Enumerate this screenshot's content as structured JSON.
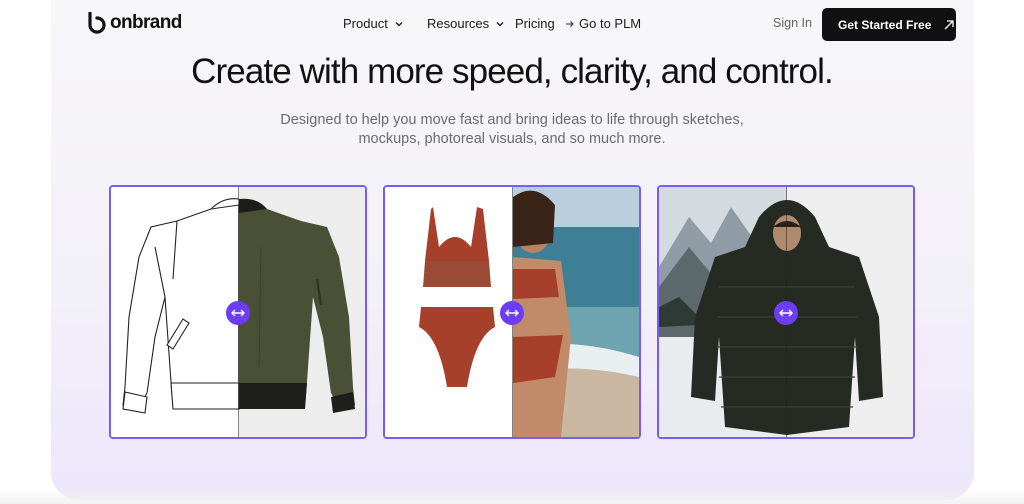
{
  "brand": {
    "name": "onbrand",
    "accent": "#6d3df5"
  },
  "nav": {
    "items": [
      {
        "label": "Product",
        "icon": "chevron-down-icon"
      },
      {
        "label": "Resources",
        "icon": "chevron-down-icon"
      },
      {
        "label": "Pricing"
      },
      {
        "label": "Go to PLM",
        "icon": "arrow-right-icon"
      }
    ],
    "signin": "Sign In",
    "cta": "Get Started Free",
    "cta_icon": "arrow-up-right-icon"
  },
  "hero": {
    "title": "Create with more speed, clarity, and control.",
    "subtitle": "Designed to help you move fast and bring ideas to life through sketches, mockups, photoreal visuals, and so much more."
  },
  "comparisons": [
    {
      "name": "bomber-jacket-sketch-to-render",
      "handle_icon": "left-right-arrow-icon"
    },
    {
      "name": "bikini-mockup-to-photo",
      "handle_icon": "left-right-arrow-icon"
    },
    {
      "name": "puffer-jacket-mockup-to-photo",
      "handle_icon": "left-right-arrow-icon"
    }
  ]
}
